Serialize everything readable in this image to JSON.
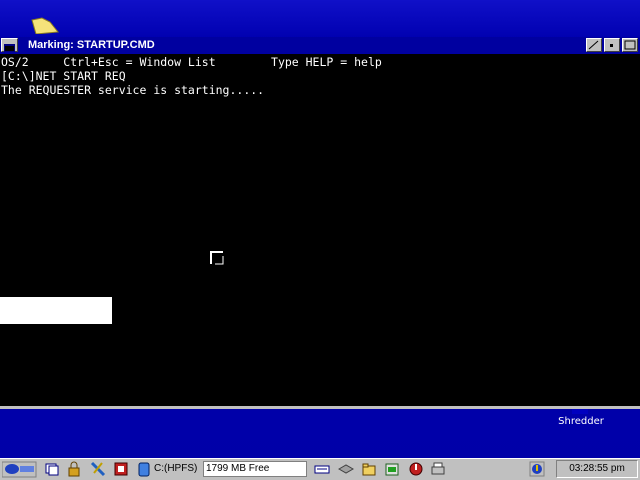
{
  "window": {
    "title": "Marking: STARTUP.CMD"
  },
  "console": {
    "lines": [
      "OS/2     Ctrl+Esc = Window List        Type HELP = help",
      "[C:\\]NET START REQ",
      "The REQUESTER service is starting....."
    ]
  },
  "desktop": {
    "shredder_label": "Shredder"
  },
  "taskbar": {
    "drive_label": "C:(HPFS)",
    "free_space": "1799 MB Free",
    "clock": "03:28:55 pm"
  },
  "colors": {
    "desktop": "#0000a8",
    "titlebar": "#0000a0",
    "console_bg": "#000000",
    "console_fg": "#ffffff"
  },
  "icons": [
    "folder-icon",
    "shredder-icon",
    "system-menu-icon",
    "minimize-icon",
    "maximize-icon",
    "cursor-icon",
    "warp-logo-icon",
    "window-list-icon",
    "lock-icon",
    "tools-icon",
    "settings-icon",
    "drive-icon",
    "keyboard-icon",
    "drives-icon",
    "folders-icon",
    "programs-icon",
    "shutdown-icon",
    "printer-icon",
    "help-icon"
  ]
}
